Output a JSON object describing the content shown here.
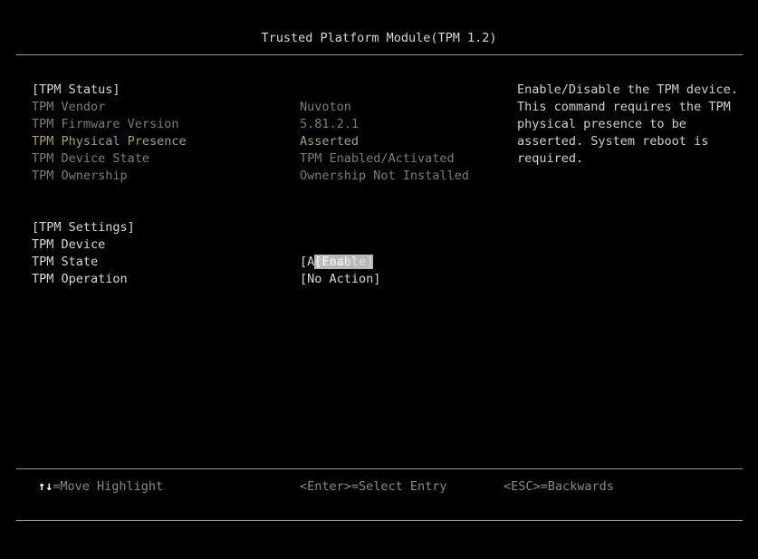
{
  "title": "Trusted Platform Module(TPM 1.2)",
  "status": {
    "header": "[TPM Status]",
    "rows": [
      {
        "label": "TPM Vendor",
        "value": "Nuvoton"
      },
      {
        "label": "TPM Firmware Version",
        "value": "5.81.2.1"
      },
      {
        "label": "TPM Physical Presence",
        "value": "Asserted"
      },
      {
        "label": "TPM Device State",
        "value": "TPM Enabled/Activated"
      },
      {
        "label": "TPM Ownership",
        "value": "Ownership Not Installed"
      }
    ]
  },
  "settings": {
    "header": "[TPM Settings]",
    "rows": [
      {
        "label": "TPM Device",
        "value": "[Enable]"
      },
      {
        "label": "TPM State",
        "value": "[Activate]"
      },
      {
        "label": "TPM Operation",
        "value": "[No Action]"
      }
    ]
  },
  "help": {
    "lines": [
      "Enable/Disable the TPM device.",
      "This command requires the TPM",
      "physical presence to be",
      "asserted. System reboot is",
      "required."
    ]
  },
  "footer": {
    "arrows": "↑↓",
    "move": "=Move Highlight",
    "enter": "<Enter>=Select Entry",
    "esc": "<ESC>=Backwards"
  }
}
